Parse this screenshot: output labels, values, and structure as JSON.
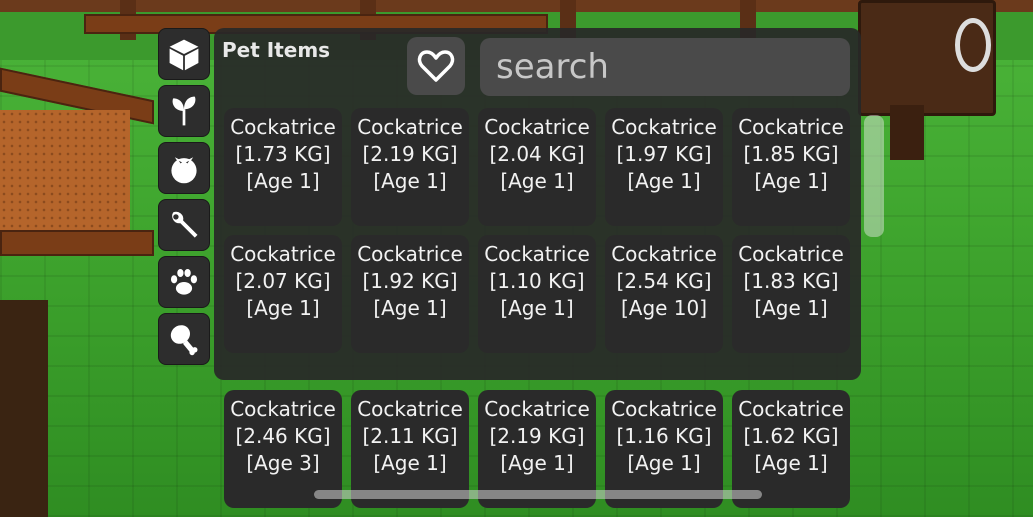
{
  "inventory": {
    "title": "Pet Items",
    "search_placeholder": "search",
    "categories": [
      {
        "name": "cube",
        "icon": "cube-icon"
      },
      {
        "name": "seeds",
        "icon": "sprout-icon"
      },
      {
        "name": "crops",
        "icon": "tomato-icon"
      },
      {
        "name": "gear",
        "icon": "wrench-icon"
      },
      {
        "name": "pets",
        "icon": "paw-icon"
      },
      {
        "name": "food",
        "icon": "drumstick-icon"
      }
    ],
    "favorite_icon": "heart-icon",
    "items": [
      {
        "name": "Cockatrice",
        "weight": "[1.73 KG]",
        "age": "[Age 1]"
      },
      {
        "name": "Cockatrice",
        "weight": "[2.19 KG]",
        "age": "[Age 1]"
      },
      {
        "name": "Cockatrice",
        "weight": "[2.04 KG]",
        "age": "[Age 1]"
      },
      {
        "name": "Cockatrice",
        "weight": "[1.97 KG]",
        "age": "[Age 1]"
      },
      {
        "name": "Cockatrice",
        "weight": "[1.85 KG]",
        "age": "[Age 1]"
      },
      {
        "name": "Cockatrice",
        "weight": "[2.07 KG]",
        "age": "[Age 1]"
      },
      {
        "name": "Cockatrice",
        "weight": "[1.92 KG]",
        "age": "[Age 1]"
      },
      {
        "name": "Cockatrice",
        "weight": "[1.10 KG]",
        "age": "[Age 1]"
      },
      {
        "name": "Cockatrice",
        "weight": "[2.54 KG]",
        "age": "[Age 10]"
      },
      {
        "name": "Cockatrice",
        "weight": "[1.83 KG]",
        "age": "[Age 1]"
      }
    ],
    "overflow_items": [
      {
        "name": "Cockatrice",
        "weight": "[2.46 KG]",
        "age": "[Age 3]"
      },
      {
        "name": "Cockatrice",
        "weight": "[2.11 KG]",
        "age": "[Age 1]"
      },
      {
        "name": "Cockatrice",
        "weight": "[2.19 KG]",
        "age": "[Age 1]"
      },
      {
        "name": "Cockatrice",
        "weight": "[1.16 KG]",
        "age": "[Age 1]"
      },
      {
        "name": "Cockatrice",
        "weight": "[1.62 KG]",
        "age": "[Age 1]"
      }
    ],
    "colors": {
      "panel": "#282828",
      "tile": "#2a2a2a",
      "text": "#f2f2f2"
    }
  }
}
